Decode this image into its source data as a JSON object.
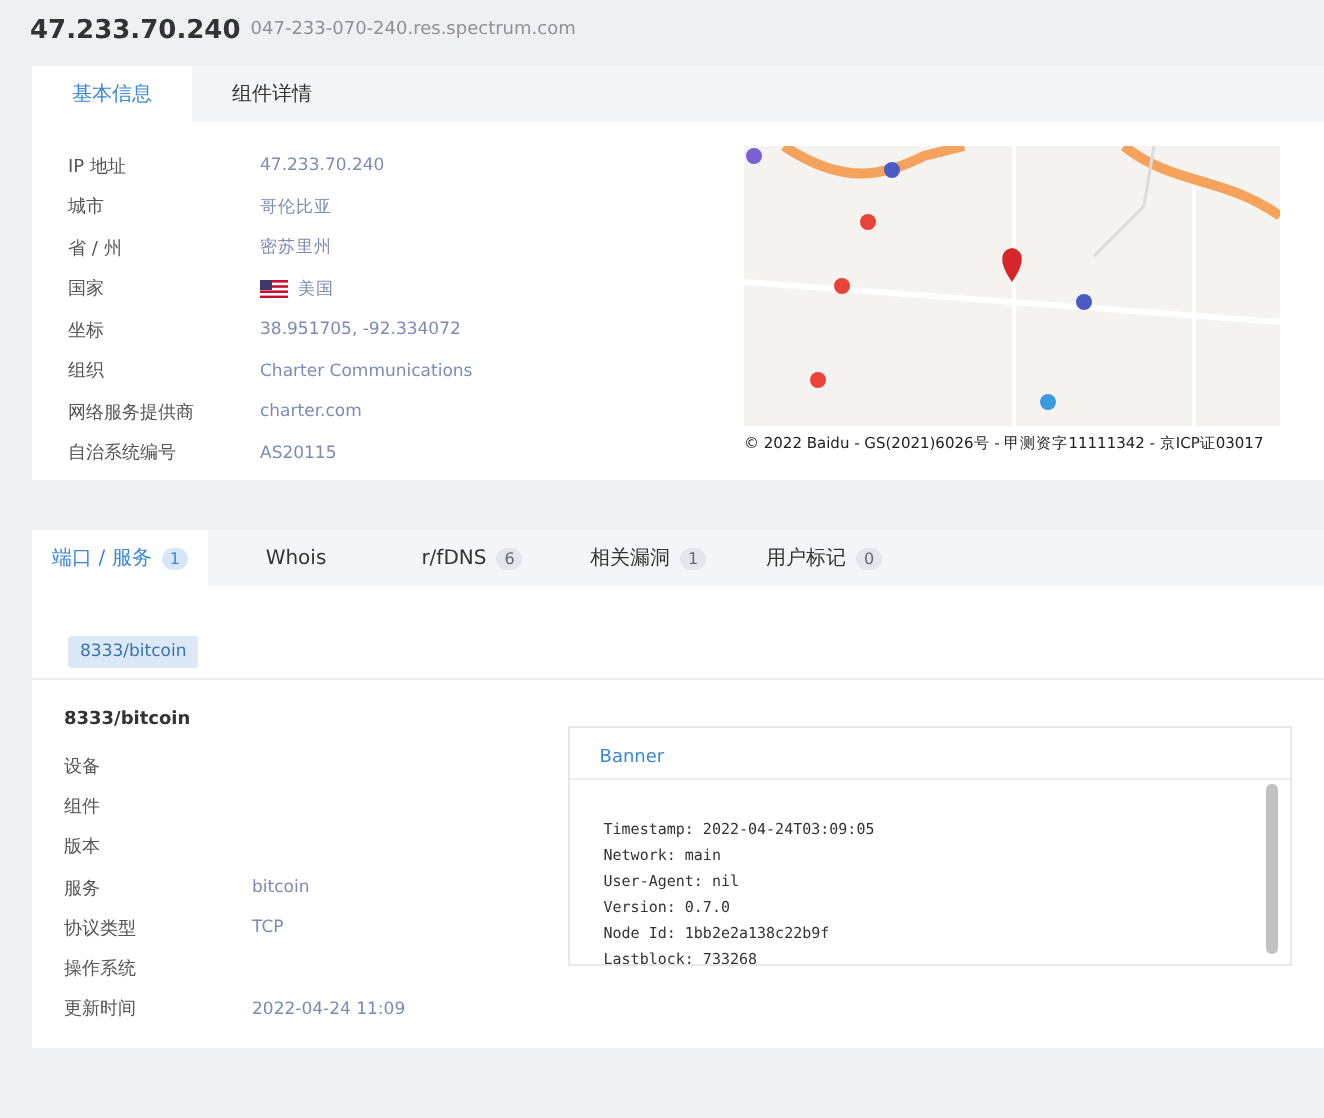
{
  "header": {
    "ip": "47.233.70.240",
    "hostname": "047-233-070-240.res.spectrum.com"
  },
  "info_tabs": [
    {
      "label": "基本信息",
      "selected": true
    },
    {
      "label": "组件详情",
      "selected": false
    }
  ],
  "info_fields": [
    {
      "label": "IP 地址",
      "value": "47.233.70.240",
      "kind": "text"
    },
    {
      "label": "城市",
      "value": "哥伦比亚",
      "kind": "text"
    },
    {
      "label": "省 / 州",
      "value": "密苏里州",
      "kind": "text"
    },
    {
      "label": "国家",
      "value": "美国",
      "kind": "country"
    },
    {
      "label": "坐标",
      "value": "38.951705, -92.334072",
      "kind": "text"
    },
    {
      "label": "组织",
      "value": "Charter Communications",
      "kind": "text"
    },
    {
      "label": "网络服务提供商",
      "value": "charter.com",
      "kind": "text"
    },
    {
      "label": "自治系统编号",
      "value": "AS20115",
      "kind": "text"
    }
  ],
  "map": {
    "copyright": "© 2022 Baidu - GS(2021)6026号 - 甲测资字11111342 - 京ICP证03017"
  },
  "service_tabs": [
    {
      "label": "端口 / 服务",
      "count": "1",
      "selected": true
    },
    {
      "label": "Whois",
      "selected": false
    },
    {
      "label": "r/fDNS",
      "count": "6",
      "selected": false
    },
    {
      "label": "相关漏洞",
      "count": "1",
      "selected": false
    },
    {
      "label": "用户标记",
      "count": "0",
      "selected": false
    }
  ],
  "port_chips": [
    "8333/bitcoin"
  ],
  "service": {
    "title": "8333/bitcoin",
    "fields": [
      {
        "label": "设备"
      },
      {
        "label": "组件"
      },
      {
        "label": "版本"
      },
      {
        "label": "服务",
        "value": "bitcoin"
      },
      {
        "label": "协议类型",
        "value": "TCP"
      },
      {
        "label": "操作系统"
      },
      {
        "label": "更新时间",
        "value": "2022-04-24 11:09"
      }
    ]
  },
  "banner": {
    "title": "Banner",
    "lines": [
      "Timestamp: 2022-04-24T03:09:05",
      "Network: main",
      "User-Agent: nil",
      "Version: 0.7.0",
      "Node Id: 1bb2e2a138c22b9f",
      "Lastblock: 733268"
    ]
  }
}
